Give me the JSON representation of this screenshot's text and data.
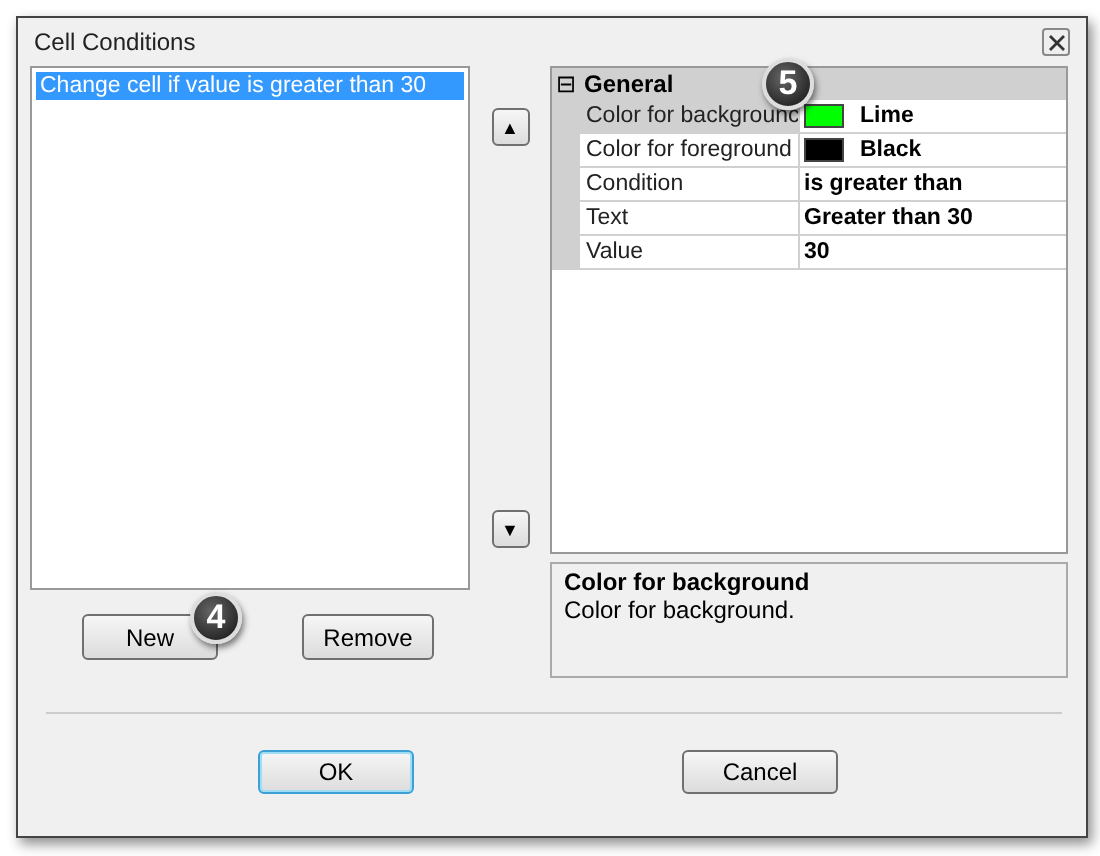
{
  "window": {
    "title": "Cell Conditions"
  },
  "conditions": [
    {
      "label": "Change cell if value is greater than 30",
      "selected": true
    }
  ],
  "move_buttons": [
    "▲",
    "▼"
  ],
  "property_grid": {
    "category": {
      "expander": "⊟",
      "label": "General"
    },
    "rows": [
      {
        "name": "Color for backgrounc",
        "value": "Lime",
        "color": "#00ff00",
        "selected": true
      },
      {
        "name": "Color for foreground",
        "value": "Black",
        "color": "#000000",
        "selected": false
      },
      {
        "name": "Condition",
        "value": "is greater than",
        "selected": false
      },
      {
        "name": "Text",
        "value": "Greater than 30",
        "selected": false
      },
      {
        "name": "Value",
        "value": "30",
        "selected": false
      }
    ]
  },
  "description": {
    "title": "Color for background",
    "text": "Color for background."
  },
  "list_buttons": [
    "New",
    "Remove"
  ],
  "callouts": [
    "5",
    "4"
  ],
  "buttons": [
    {
      "label": "OK",
      "default": true
    },
    {
      "label": "Cancel",
      "default": false
    }
  ]
}
